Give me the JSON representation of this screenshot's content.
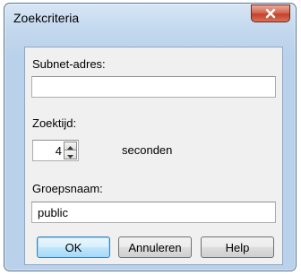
{
  "window": {
    "title": "Zoekcriteria"
  },
  "subnet": {
    "label": "Subnet-adres:",
    "value": ""
  },
  "search_time": {
    "label": "Zoektijd:",
    "value": "4",
    "unit": "seconden"
  },
  "group": {
    "label": "Groepsnaam:",
    "value": "public"
  },
  "buttons": {
    "ok": "OK",
    "cancel": "Annuleren",
    "help": "Help"
  },
  "icons": {
    "close": "close-icon",
    "spin_up": "arrow-up-icon",
    "spin_down": "arrow-down-icon"
  },
  "colors": {
    "frame": "#b9d1ea",
    "close_button": "#c4402a",
    "default_button": "#bee6fd"
  }
}
